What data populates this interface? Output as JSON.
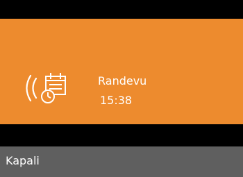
{
  "alert": {
    "title": "Randevu",
    "time": "15:38",
    "icon": "appointment-calendar-clock-icon",
    "ring_indicator_icon": "ringing-wave-icon"
  },
  "softkeys": {
    "left_label": "Kapali"
  },
  "colors": {
    "background": "#000000",
    "alert_panel": "#ED8B2E",
    "softkey_bar": "#5F5F5F",
    "text": "#FFFFFF"
  }
}
